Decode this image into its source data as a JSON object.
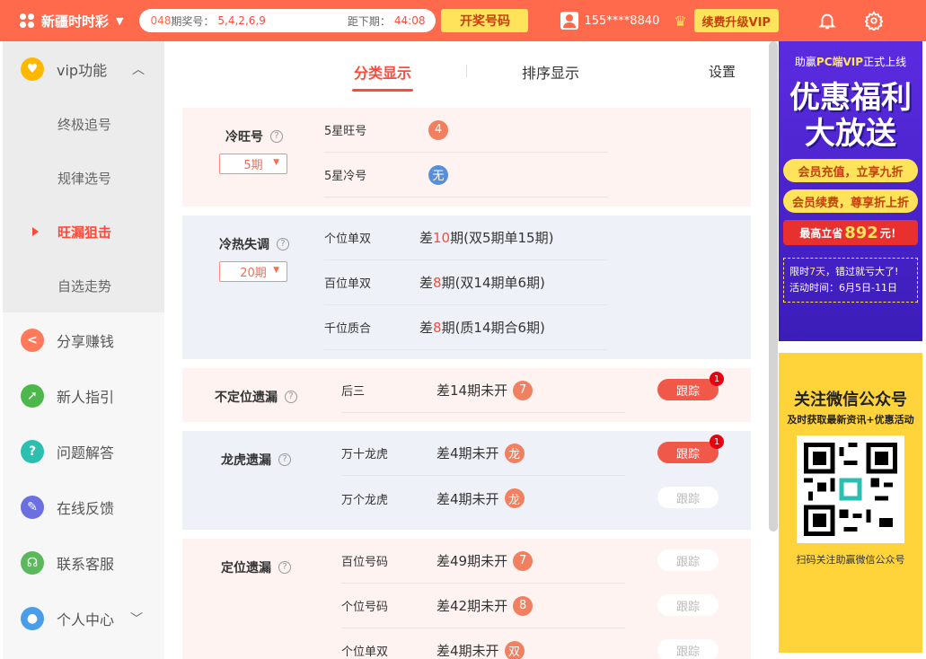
{
  "topbar": {
    "app_title": "新疆时时彩",
    "issue": "048",
    "issue_label": "期奖号：",
    "winning_numbers": "5,4,2,6,9",
    "countdown_label": "距下期：",
    "countdown": "44:08",
    "draw_button": "开奖号码",
    "phone": "155****8840",
    "vip_button": "续费升级VIP"
  },
  "sidebar": {
    "vip_title": "vip功能",
    "vip_items": [
      "终极追号",
      "规律选号",
      "旺漏狙击",
      "自选走势"
    ],
    "items": [
      "分享赚钱",
      "新人指引",
      "问题解答",
      "在线反馈",
      "联系客服",
      "个人中心"
    ]
  },
  "tabs": {
    "category": "分类显示",
    "sort": "排序显示",
    "settings": "设置"
  },
  "sections": {
    "cold_hot": {
      "title": "冷旺号",
      "period": "5期",
      "rows": [
        {
          "name": "5星旺号",
          "ball": "4"
        },
        {
          "name": "5星冷号",
          "ball": "无"
        }
      ]
    },
    "imbalance": {
      "title": "冷热失调",
      "period": "20期",
      "rows": [
        {
          "name": "个位单双",
          "pre": "差",
          "hl": "10",
          "post": "期(双5期单15期)"
        },
        {
          "name": "百位单双",
          "pre": "差",
          "hl": "8",
          "post": "期(双14期单6期)"
        },
        {
          "name": "千位质合",
          "pre": "差",
          "hl": "8",
          "post": "期(质14期合6期)"
        }
      ]
    },
    "unfixed": {
      "title": "不定位遗漏",
      "rows": [
        {
          "name": "后三",
          "text": "差14期未开",
          "ball": "7",
          "track": "跟踪",
          "badge": "1"
        }
      ]
    },
    "dragon": {
      "title": "龙虎遗漏",
      "rows": [
        {
          "name": "万十龙虎",
          "text": "差4期未开",
          "ball": "龙",
          "track": "跟踪",
          "badge": "1"
        },
        {
          "name": "万个龙虎",
          "text": "差4期未开",
          "ball": "龙",
          "track": "跟踪"
        }
      ]
    },
    "fixed": {
      "title": "定位遗漏",
      "rows": [
        {
          "name": "百位号码",
          "text": "差49期未开",
          "ball": "7",
          "track": "跟踪"
        },
        {
          "name": "个位号码",
          "text": "差42期未开",
          "ball": "8",
          "track": "跟踪"
        },
        {
          "name": "个位单双",
          "text": "差4期未开",
          "ball": "双",
          "track": "跟踪"
        }
      ]
    }
  },
  "ad1": {
    "top_pre": "助赢",
    "top_hl": "PC端VIP",
    "top_post": "正式上线",
    "line1": "优惠福利",
    "line2": "大放送",
    "pill1": "会员充值，立享九折",
    "pill2": "会员续费，尊享折上折",
    "pill3_pre": "最高立省",
    "pill3_amount": "892",
    "pill3_post": "元！",
    "note_pre": "限时",
    "note_days": "7天",
    "note_post": "，错过就亏大了!",
    "note_time": "活动时间：6月5日-11日"
  },
  "ad2": {
    "title": "关注微信公众号",
    "subtitle": "及时获取最新资讯+优惠活动",
    "footer": "扫码关注助赢微信公众号"
  }
}
